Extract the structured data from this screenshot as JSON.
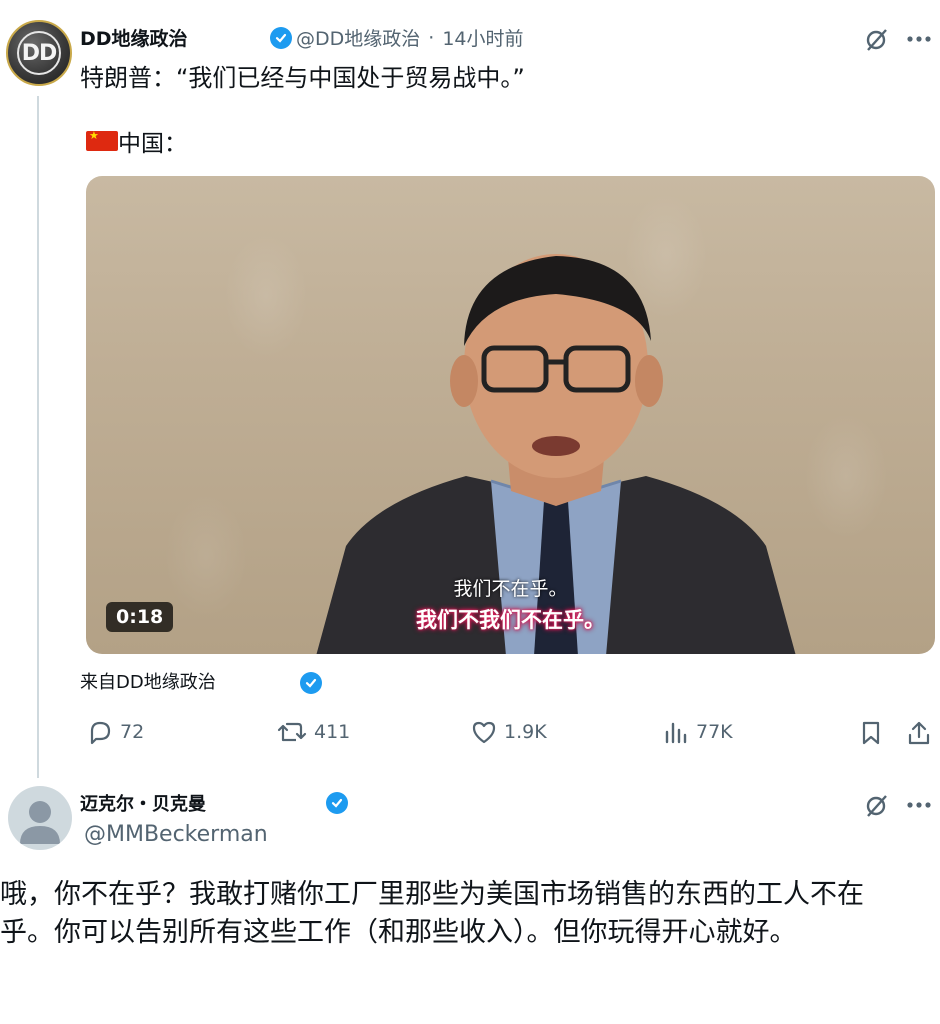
{
  "tweet": {
    "author_name": "DD地缘政治",
    "author_handle": "@DD地缘政治",
    "separator": "·",
    "time": "14小时前",
    "avatar_text": "DD",
    "text": "特朗普：“我们已经与中国处于贸易战中。”",
    "quote_label": "中国：",
    "video": {
      "duration": "0:18",
      "subtitle_line1": "我们不在乎。",
      "subtitle_line2": "我们不我们不在乎。"
    },
    "source": "来自DD地缘政治",
    "actions": {
      "replies": "72",
      "reposts": "411",
      "likes": "1.9K",
      "views": "77K"
    }
  },
  "reply": {
    "author_name": "迈克尔・贝克曼",
    "author_handle": "@MMBeckerman",
    "text": "哦，你不在乎？我敢打赌你工厂里那些为美国市场销售的东西的工人不在乎。你可以告别所有这些工作（和那些收入）。但你玩得开心就好。"
  },
  "colors": {
    "accent": "#1d9bf0",
    "muted": "#536471",
    "text": "#0f1419"
  },
  "icons": [
    "grok-icon",
    "more-icon",
    "verified-icon",
    "reply-icon",
    "repost-icon",
    "like-icon",
    "views-icon",
    "bookmark-icon",
    "share-icon"
  ]
}
